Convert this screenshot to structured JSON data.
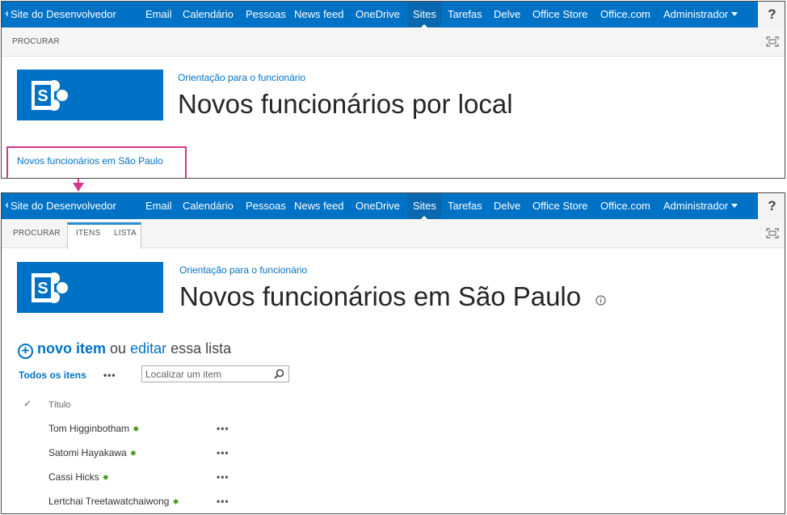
{
  "suitebar": {
    "site": "Site do Desenvolvedor",
    "nav": [
      "Email",
      "Calendário",
      "Pessoas",
      "News feed",
      "OneDrive",
      "Sites",
      "Tarefas",
      "Delve",
      "Office Store",
      "Office.com"
    ],
    "active": "Sites",
    "user": "Administrador",
    "help": "?"
  },
  "panel1": {
    "ribbon_tabs": [
      "PROCURAR"
    ],
    "breadcrumb": "Orientação para o funcionário",
    "title": "Novos funcionários por local",
    "sublink": "Novos funcionários em São Paulo"
  },
  "panel2": {
    "ribbon_tabs": [
      "PROCURAR",
      "ITENS",
      "LISTA"
    ],
    "breadcrumb": "Orientação para o funcionário",
    "title": "Novos funcionários em São Paulo",
    "new_item": "novo item",
    "or": "ou",
    "edit": "editar",
    "this_list": "essa lista",
    "view": "Todos os itens",
    "ellipsis": "•••",
    "search_placeholder": "Localizar um item",
    "column_title": "Título",
    "items": [
      {
        "name": "Tom Higginbotham"
      },
      {
        "name": "Satomi Hayakawa"
      },
      {
        "name": "Cassi Hicks"
      },
      {
        "name": "Lertchai Treetawatchaiwong"
      }
    ]
  },
  "colors": {
    "brand": "#0072c6",
    "highlight": "#d4378b",
    "new_badge": "#4b9b1b"
  },
  "icons": {
    "new": "sparkle-icon",
    "search": "search-icon",
    "focus": "focus-on-content-icon",
    "info": "info-icon",
    "check": "check-icon"
  }
}
